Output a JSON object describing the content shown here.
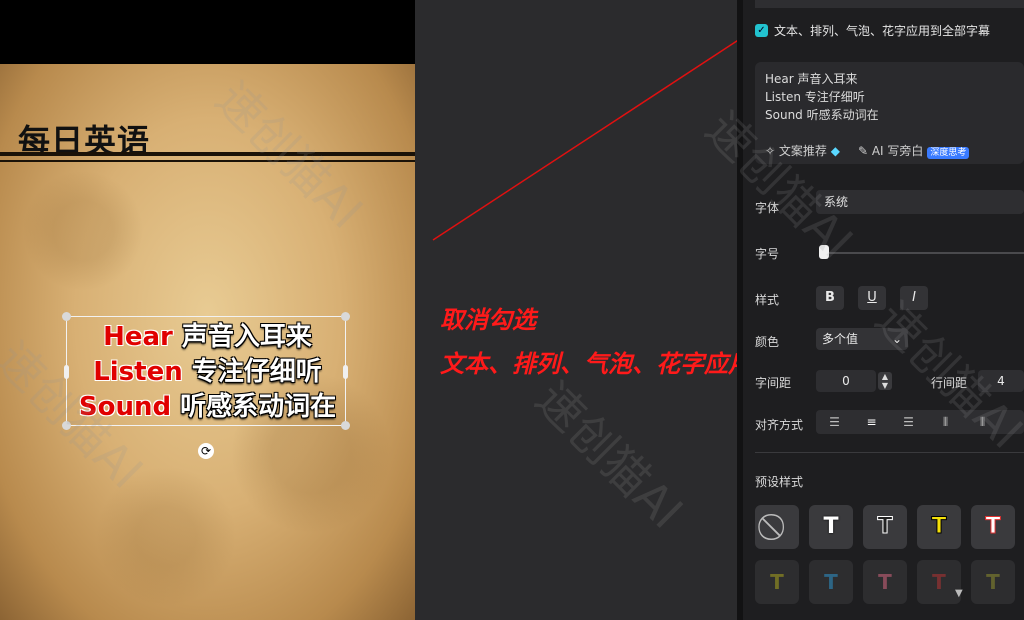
{
  "preview": {
    "title": "每日英语",
    "subtitle_lines": [
      {
        "en": "Hear",
        "zh": " 声音入耳来"
      },
      {
        "en": "Listen",
        "zh": " 专注仔细听"
      },
      {
        "en": "Sound",
        "zh": " 听感系动词在"
      }
    ],
    "rotate_icon": "⟳"
  },
  "annotation": {
    "line1": "取消勾选",
    "line2": "文本、排列、气泡、花字应用到全部字幕",
    "arrow_color": "#e01010"
  },
  "panel": {
    "apply_all_label": "文本、排列、气泡、花字应用到全部字幕",
    "apply_all_checked": true,
    "text_lines": [
      "Hear 声音入耳来",
      "Listen 专注仔细听",
      "Sound 听感系动词在"
    ],
    "copy_recommend": "文案推荐",
    "ai_narration": "AI 写旁白",
    "deep_think_badge": "深度思考",
    "font_label": "字体",
    "font_value": "系统",
    "size_label": "字号",
    "style_label": "样式",
    "style_buttons": [
      "B",
      "U",
      "I"
    ],
    "color_label": "颜色",
    "color_value": "多个值",
    "letter_spacing_label": "字间距",
    "letter_spacing_value": "0",
    "line_spacing_label": "行间距",
    "line_spacing_value": "4",
    "align_label": "对齐方式",
    "preset_label": "预设样式",
    "preset_glyph": "T",
    "accent": "#22c3cf"
  },
  "watermark": "速创猫AI"
}
